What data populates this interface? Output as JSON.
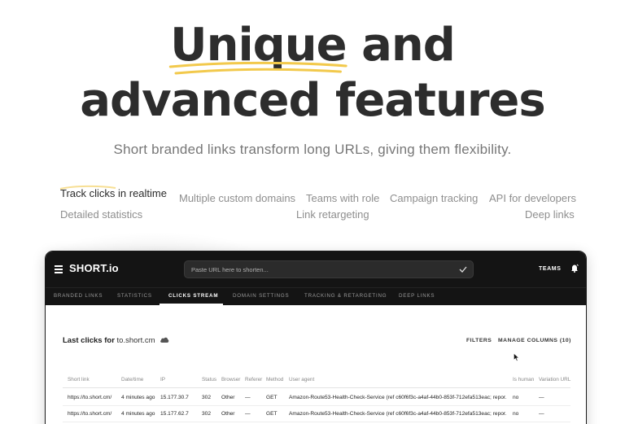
{
  "hero": {
    "line1_highlight": "Unique",
    "line1_rest": "and",
    "line2": "advanced features",
    "subtitle": "Short branded links transform long URLs, giving them flexibility."
  },
  "features": {
    "row1": [
      "Track clicks in realtime",
      "Multiple custom domains",
      "Teams with role",
      "Campaign tracking",
      "API for developers"
    ],
    "row2": [
      "Detailed statistics",
      "Link retargeting",
      "Deep links"
    ],
    "active": "Track clicks in realtime"
  },
  "app": {
    "logo_mark": "S",
    "logo_text": "HORT.io",
    "url_placeholder": "Paste URL here to shorten...",
    "teams_label": "TEAMS",
    "tabs": [
      "BRANDED LINKS",
      "STATISTICS",
      "CLICKS STREAM",
      "DOMAIN SETTINGS",
      "TRACKING & RETARGETING",
      "DEEP LINKS"
    ],
    "active_tab": "CLICKS STREAM",
    "section_title": "Last clicks for",
    "section_domain": "to.short.cm",
    "filters_label": "FILTERS",
    "manage_columns_label": "MANAGE COLUMNS (10)",
    "table": {
      "columns": [
        "Short link",
        "Date/time",
        "IP",
        "Status",
        "Browser",
        "Referer",
        "Method",
        "User agent",
        "Is human",
        "Variation URL"
      ],
      "rows": [
        [
          "https://to.short.cm/",
          "4 minutes ago",
          "15.177.30.7",
          "302",
          "Other",
          "—",
          "GET",
          "Amazon-Route53-Health-Check-Service (ref c60f6f3c-a4af-44b0-853f-712efa513eac; repor...",
          "no",
          "—"
        ],
        [
          "https://to.short.cm/",
          "4 minutes ago",
          "15.177.62.7",
          "302",
          "Other",
          "—",
          "GET",
          "Amazon-Route53-Health-Check-Service (ref c60f6f3c-a4af-44b0-853f-712efa513eac; repor...",
          "no",
          "—"
        ]
      ]
    }
  },
  "colors": {
    "accent_yellow": "#f2c94c",
    "dark_bar": "#141414",
    "heading": "#2d2d2d"
  },
  "icons": [
    "menu-icon",
    "check-icon",
    "bell-icon",
    "cloud-icon",
    "cursor-icon"
  ]
}
